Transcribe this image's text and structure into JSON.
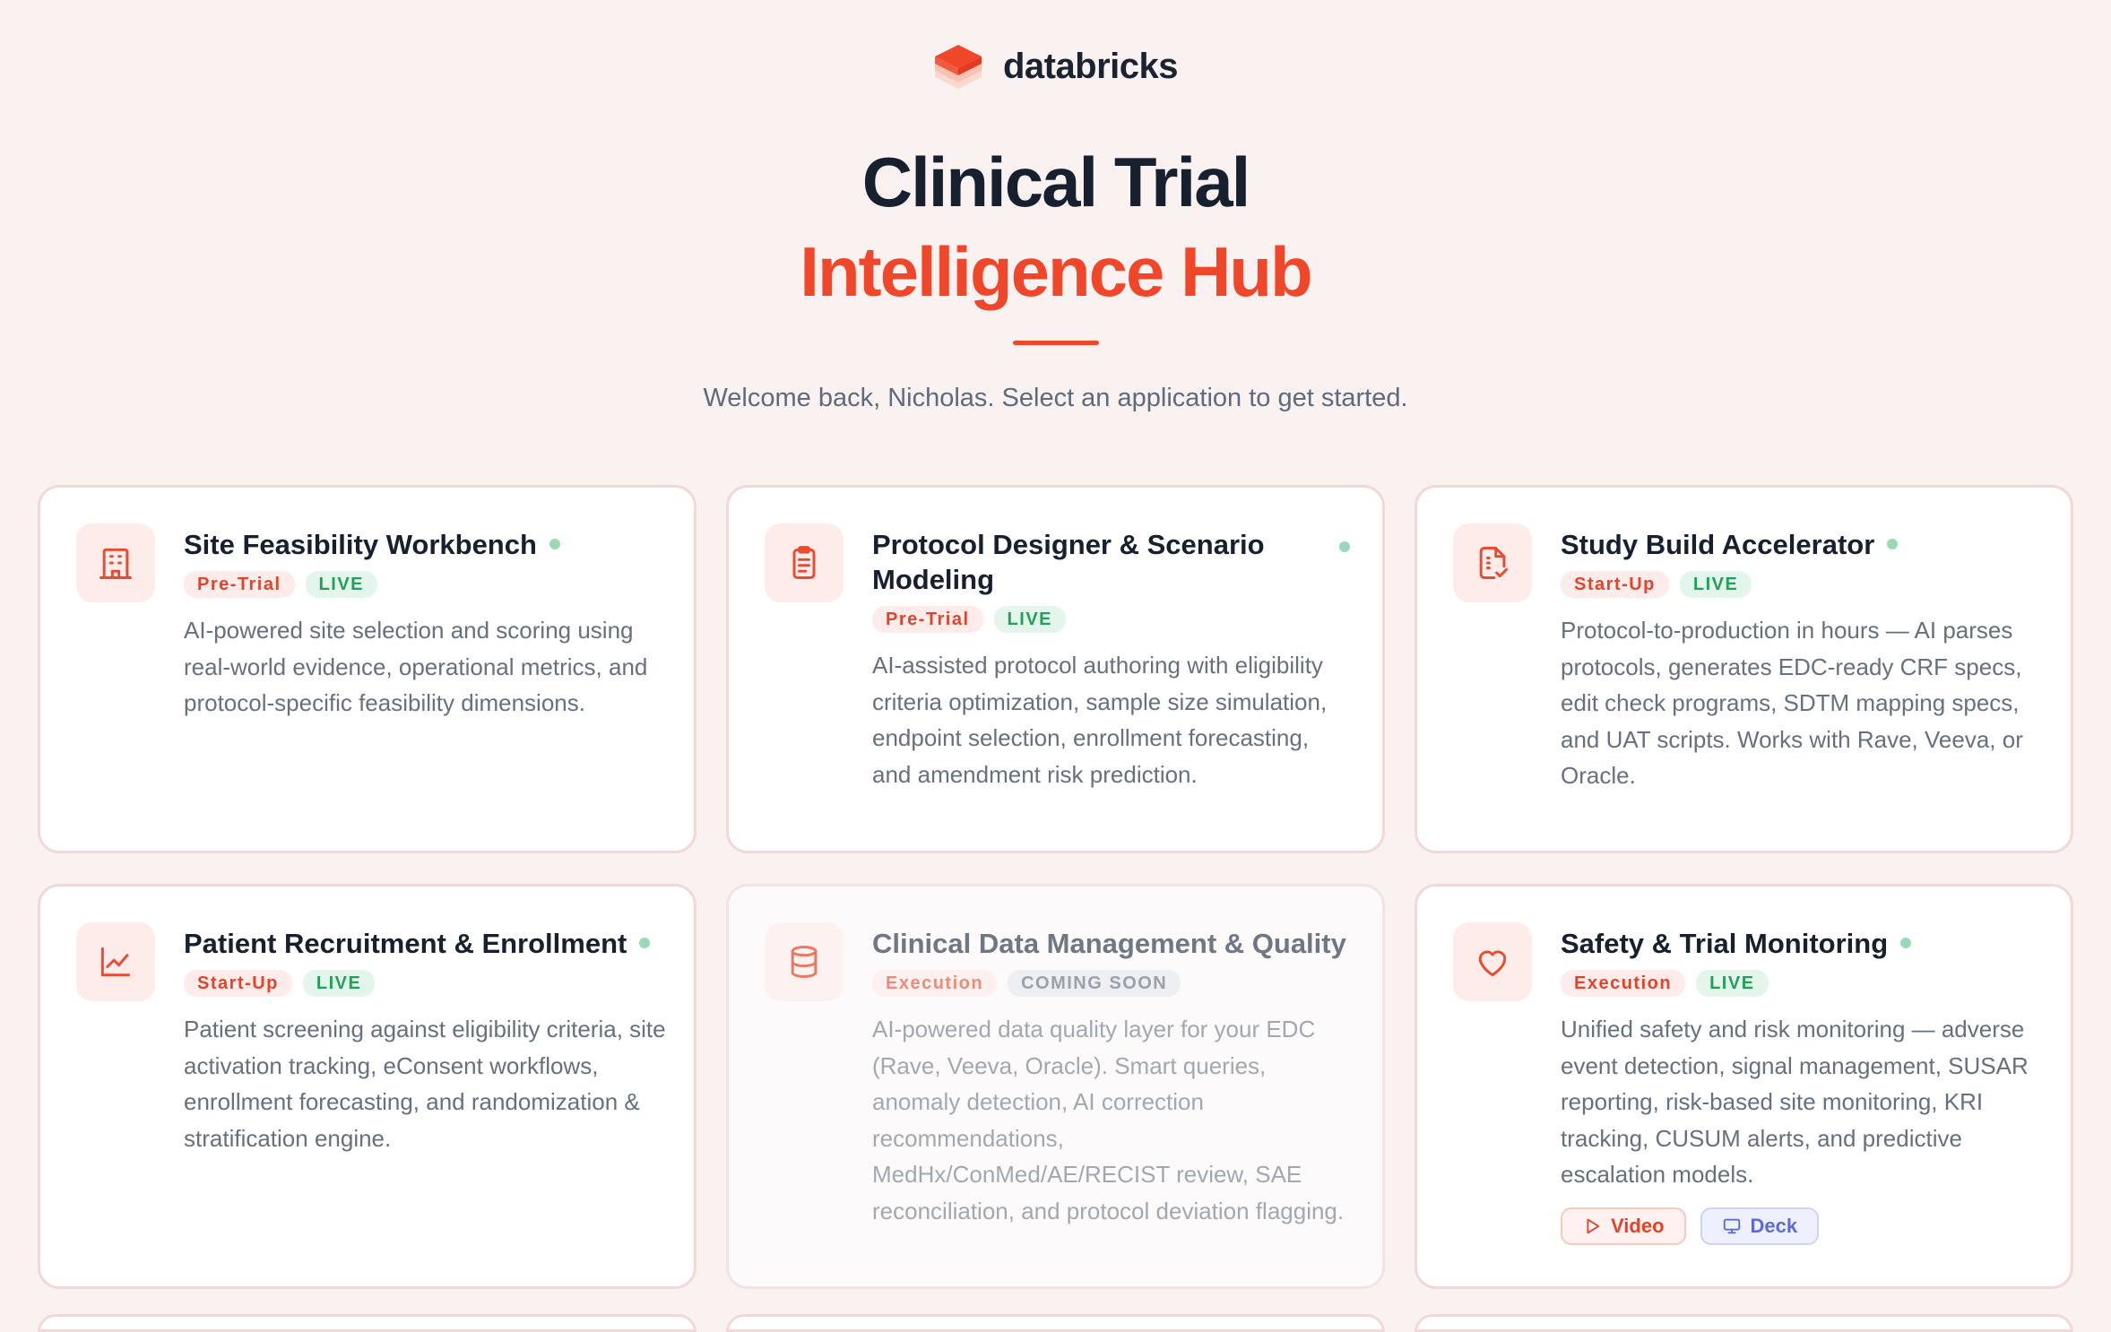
{
  "brand": {
    "name": "databricks",
    "logo_icon": "databricks-logo",
    "accent": "#f0472b"
  },
  "hero": {
    "title_line1": "Clinical Trial",
    "title_line2": "Intelligence Hub",
    "welcome": "Welcome back, Nicholas. Select an application to get started."
  },
  "cards": [
    {
      "title": "Site Feasibility Workbench",
      "icon": "building-icon",
      "phase": "Pre-Trial",
      "status": "LIVE",
      "description": "AI-powered site selection and scoring using real-world evidence, operational metrics, and protocol-specific feasibility dimensions."
    },
    {
      "title": "Protocol Designer & Scenario Modeling",
      "icon": "clipboard-icon",
      "phase": "Pre-Trial",
      "status": "LIVE",
      "description": "AI-assisted protocol authoring with eligibility criteria optimization, sample size simulation, endpoint selection, enrollment forecasting, and amendment risk prediction."
    },
    {
      "title": "Study Build Accelerator",
      "icon": "document-check-icon",
      "phase": "Start-Up",
      "status": "LIVE",
      "description": "Protocol-to-production in hours — AI parses protocols, generates EDC-ready CRF specs, edit check programs, SDTM mapping specs, and UAT scripts. Works with Rave, Veeva, or Oracle."
    },
    {
      "title": "Patient Recruitment & Enrollment",
      "icon": "line-chart-icon",
      "phase": "Start-Up",
      "status": "LIVE",
      "description": "Patient screening against eligibility criteria, site activation tracking, eConsent workflows, enrollment forecasting, and randomization & stratification engine."
    },
    {
      "title": "Clinical Data Management & Quality",
      "icon": "database-icon",
      "phase": "Execution",
      "status": "COMING SOON",
      "description": "AI-powered data quality layer for your EDC (Rave, Veeva, Oracle). Smart queries, anomaly detection, AI correction recommendations, MedHx/ConMed/AE/RECIST review, SAE reconciliation, and protocol deviation flagging."
    },
    {
      "title": "Safety & Trial Monitoring",
      "icon": "heart-icon",
      "phase": "Execution",
      "status": "LIVE",
      "description": "Unified safety and risk monitoring — adverse event detection, signal management, SUSAR reporting, risk-based site monitoring, KRI tracking, CUSUM alerts, and predictive escalation models.",
      "actions": {
        "video": "Video",
        "deck": "Deck"
      }
    }
  ]
}
